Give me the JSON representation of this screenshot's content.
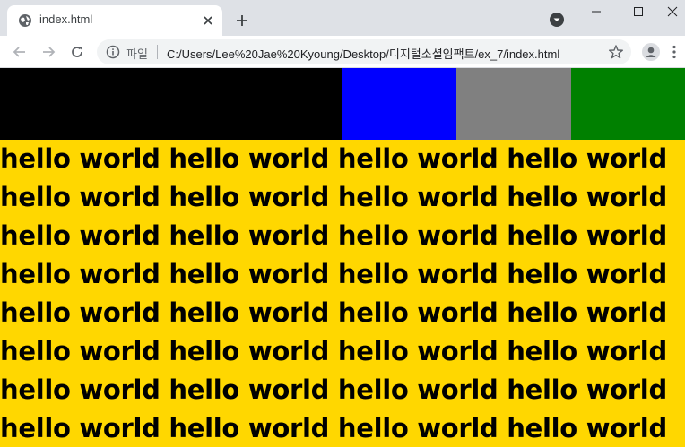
{
  "browser": {
    "tab": {
      "title": "index.html"
    },
    "address": {
      "scheme_label": "파일",
      "url": "C:/Users/Lee%20Jae%20Kyoung/Desktop/디지털소셜임팩트/ex_7/index.html"
    },
    "icons": {
      "favicon": "globe-icon",
      "tab_close": "close-icon",
      "new_tab": "plus-icon",
      "profile_menu": "chevron-down-icon",
      "minimize": "minimize-icon",
      "maximize": "maximize-icon",
      "window_close": "close-icon",
      "back": "arrow-left-icon",
      "forward": "arrow-right-icon",
      "reload": "reload-icon",
      "info": "info-icon",
      "bookmark": "star-icon",
      "account": "account-icon",
      "menu": "more-vert-icon"
    }
  },
  "page": {
    "boxes": [
      {
        "name": "box-black",
        "color": "#000000"
      },
      {
        "name": "box-blue",
        "color": "#0000ff"
      },
      {
        "name": "box-gray",
        "color": "#808080"
      },
      {
        "name": "box-green",
        "color": "#008000"
      }
    ],
    "text_background": "#ffd700",
    "lines": [
      "hello world hello world hello world hello world",
      "hello world hello world hello world hello world",
      "hello world hello world hello world hello world",
      "hello world hello world hello world hello world",
      "hello world hello world hello world hello world",
      "hello world hello world hello world hello world",
      "hello world hello world hello world hello world",
      "hello world hello world hello world hello world"
    ]
  }
}
